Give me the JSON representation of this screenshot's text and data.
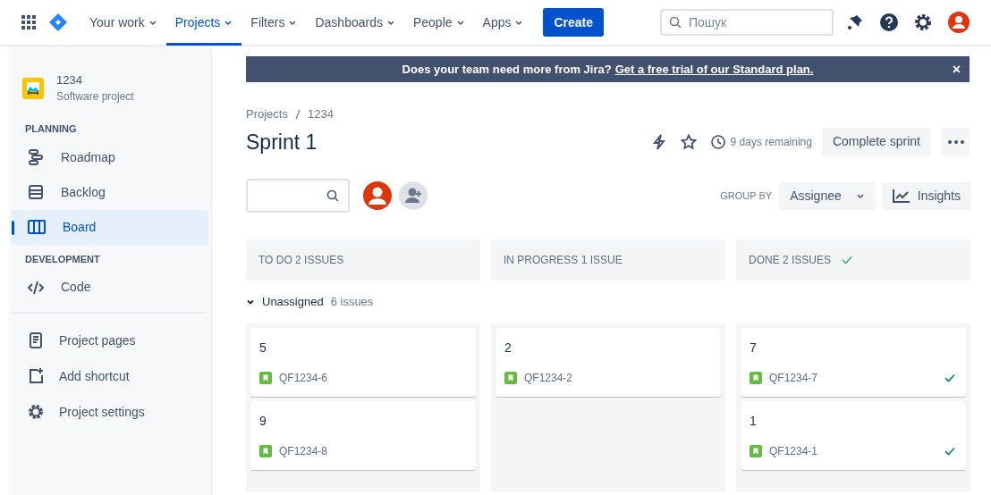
{
  "nav": {
    "items": [
      {
        "label": "Your work",
        "selected": false
      },
      {
        "label": "Projects",
        "selected": true
      },
      {
        "label": "Filters",
        "selected": false
      },
      {
        "label": "Dashboards",
        "selected": false
      },
      {
        "label": "People",
        "selected": false
      },
      {
        "label": "Apps",
        "selected": false
      }
    ],
    "create": "Create",
    "search": {
      "placeholder": "Пошук"
    }
  },
  "sidebar": {
    "project": {
      "name": "1234",
      "type": "Software project"
    },
    "sections": [
      {
        "title": "PLANNING",
        "items": [
          {
            "kind": "roadmap",
            "label": "Roadmap",
            "selected": false
          },
          {
            "kind": "backlog",
            "label": "Backlog",
            "selected": false
          },
          {
            "kind": "board",
            "label": "Board",
            "selected": true
          }
        ]
      },
      {
        "title": "DEVELOPMENT",
        "items": [
          {
            "kind": "code",
            "label": "Code",
            "selected": false
          }
        ]
      }
    ],
    "links": [
      {
        "kind": "pages",
        "label": "Project pages"
      },
      {
        "kind": "shortcut",
        "label": "Add shortcut"
      },
      {
        "kind": "settings",
        "label": "Project settings"
      }
    ]
  },
  "banner": {
    "text": "Does your team need more from Jira?",
    "link": "Get a free trial of our Standard plan.",
    "close": "×"
  },
  "breadcrumb": [
    "Projects",
    "1234"
  ],
  "title": "Sprint 1",
  "remaining": "9 days remaining",
  "complete_button": "Complete sprint",
  "group_by": {
    "label": "GROUP BY",
    "value": "Assignee"
  },
  "insights": "Insights",
  "columns": [
    {
      "title": "TO DO 2 ISSUES",
      "done": false,
      "cards": [
        {
          "title": "5",
          "key": "QF1234-6",
          "done": false
        },
        {
          "title": "9",
          "key": "QF1234-8",
          "done": false
        }
      ]
    },
    {
      "title": "IN PROGRESS 1 ISSUE",
      "done": false,
      "cards": [
        {
          "title": "2",
          "key": "QF1234-2",
          "done": false
        }
      ]
    },
    {
      "title": "DONE 2 ISSUES",
      "done": true,
      "cards": [
        {
          "title": "7",
          "key": "QF1234-7",
          "done": true
        },
        {
          "title": "1",
          "key": "QF1234-1",
          "done": true
        }
      ]
    }
  ],
  "swimlane": {
    "label": "Unassigned",
    "count": "6 issues",
    "expanded": true
  }
}
